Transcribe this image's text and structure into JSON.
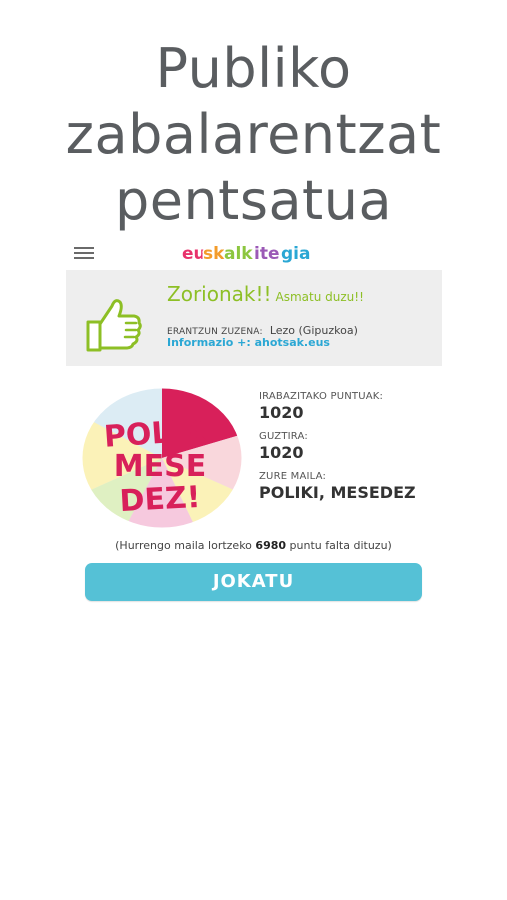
{
  "promo": {
    "line1": "Publiko",
    "line2": "zabalarentzat",
    "line3": "pentsatua"
  },
  "header": {
    "logo_text": "euskalkitegia"
  },
  "result": {
    "title": "Zorionak!!",
    "subtitle": "Asmatu duzu!!",
    "answer_label": "ERANTZUN ZUZENA:",
    "answer_value": "Lezo (Gipuzkoa)",
    "info_text": "Informazio +: ahotsak.eus"
  },
  "badge": {
    "line1": "POLIKI",
    "line2": "MESE",
    "line3": "DEZ!"
  },
  "stats": {
    "points_label": "IRABAZITAKO PUNTUAK:",
    "points_value": "1020",
    "total_label": "GUZTIRA:",
    "total_value": "1020",
    "level_label": "ZURE MAILA:",
    "level_value": "POLIKI, MESEDEZ"
  },
  "next_level": {
    "prefix": "(Hurrengo maila lortzeko ",
    "points": "6980",
    "suffix": " puntu falta dituzu)"
  },
  "play_button": {
    "label": "JOKATU"
  },
  "colors": {
    "accent_green": "#8dbf25",
    "link_blue": "#2aa7d4",
    "button_blue": "#55c1d6",
    "badge_pink": "#d8205a"
  }
}
